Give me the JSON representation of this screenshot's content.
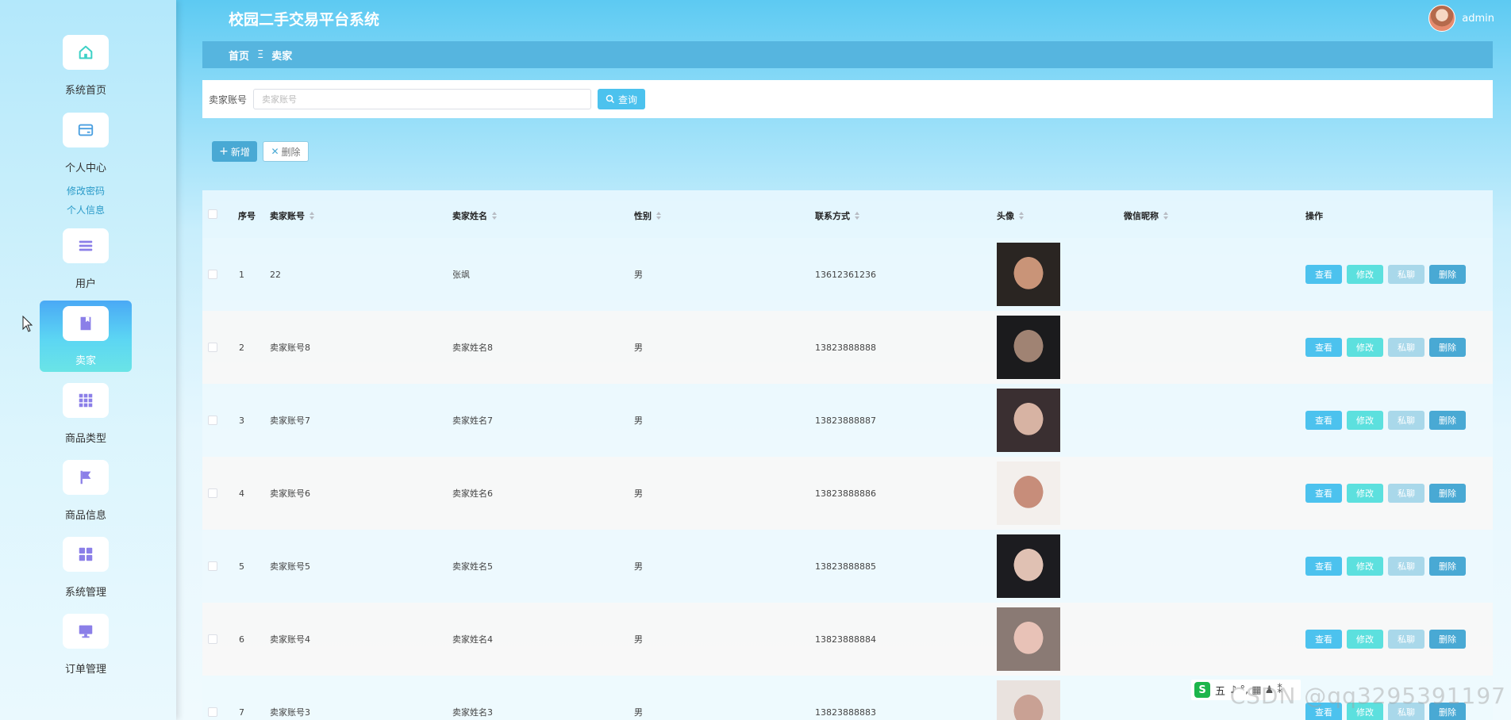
{
  "app": {
    "title": "校园二手交易平台系统"
  },
  "user": {
    "name": "admin"
  },
  "sidebar": {
    "items": [
      {
        "label": "系统首页",
        "icon": "home-icon"
      },
      {
        "label": "个人中心",
        "icon": "card-icon"
      },
      {
        "label": "用户",
        "icon": "list-icon"
      },
      {
        "label": "卖家",
        "icon": "book-icon"
      },
      {
        "label": "商品类型",
        "icon": "grid-icon"
      },
      {
        "label": "商品信息",
        "icon": "flag-icon"
      },
      {
        "label": "系统管理",
        "icon": "blocks-icon"
      },
      {
        "label": "订单管理",
        "icon": "monitor-icon"
      }
    ],
    "sub_items": [
      "修改密码",
      "个人信息"
    ],
    "active": "卖家"
  },
  "breadcrumb": {
    "home": "首页",
    "separator": "Ξ",
    "current": "卖家"
  },
  "search": {
    "label": "卖家账号",
    "placeholder": "卖家账号",
    "value": "",
    "button": "查询"
  },
  "actions": {
    "add": "新增",
    "delete": "删除"
  },
  "table": {
    "headers": {
      "index": "序号",
      "account": "卖家账号",
      "name": "卖家姓名",
      "gender": "性别",
      "contact": "联系方式",
      "avatar": "头像",
      "wechat": "微信昵称",
      "ops": "操作"
    },
    "rows": [
      {
        "index": "1",
        "account": "22",
        "name": "张飒",
        "gender": "男",
        "contact": "13612361236",
        "wechat": ""
      },
      {
        "index": "2",
        "account": "卖家账号8",
        "name": "卖家姓名8",
        "gender": "男",
        "contact": "13823888888",
        "wechat": ""
      },
      {
        "index": "3",
        "account": "卖家账号7",
        "name": "卖家姓名7",
        "gender": "男",
        "contact": "13823888887",
        "wechat": ""
      },
      {
        "index": "4",
        "account": "卖家账号6",
        "name": "卖家姓名6",
        "gender": "男",
        "contact": "13823888886",
        "wechat": ""
      },
      {
        "index": "5",
        "account": "卖家账号5",
        "name": "卖家姓名5",
        "gender": "男",
        "contact": "13823888885",
        "wechat": ""
      },
      {
        "index": "6",
        "account": "卖家账号4",
        "name": "卖家姓名4",
        "gender": "男",
        "contact": "13823888884",
        "wechat": ""
      },
      {
        "index": "7",
        "account": "卖家账号3",
        "name": "卖家姓名3",
        "gender": "男",
        "contact": "13823888883",
        "wechat": ""
      }
    ],
    "row_actions": {
      "view": "查看",
      "edit": "修改",
      "chat": "私聊",
      "delete": "删除"
    }
  },
  "overlay": {
    "watermark": "CSDN @qq3295391197",
    "ime_char": "S",
    "ime_mode": "五"
  },
  "colors": {
    "accent": "#4cc2ee",
    "breadcrumb_bg": "#56b5df",
    "edit": "#5ce0de",
    "chat": "#a9d8ea",
    "delete": "#49a9d4"
  }
}
